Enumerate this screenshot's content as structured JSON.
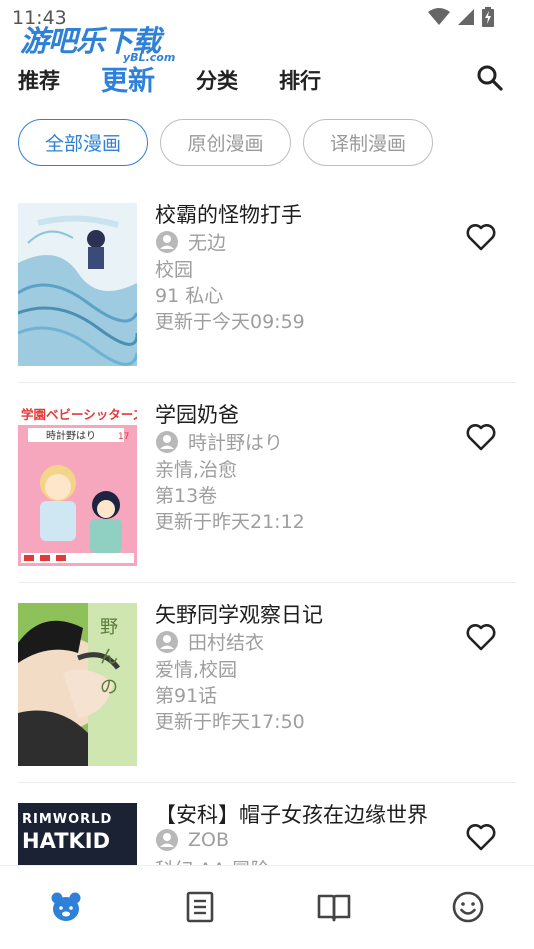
{
  "status": {
    "time": "11:43"
  },
  "watermark": {
    "main": "游吧乐下载",
    "sub": "yBL.com"
  },
  "nav": {
    "tabs": [
      {
        "label": "推荐",
        "active": false
      },
      {
        "label": "更新",
        "active": true
      },
      {
        "label": "分类",
        "active": false
      },
      {
        "label": "排行",
        "active": false
      }
    ],
    "search_icon": "search-icon"
  },
  "filters": [
    {
      "label": "全部漫画",
      "active": true
    },
    {
      "label": "原创漫画",
      "active": false
    },
    {
      "label": "译制漫画",
      "active": false
    }
  ],
  "comics": [
    {
      "title": "校霸的怪物打手",
      "author": "无边",
      "tags": "校园",
      "chapter": "91 私心",
      "updated": "更新于今天09:59"
    },
    {
      "title": "学园奶爸",
      "author": "時計野はり",
      "tags": "亲情,治愈",
      "chapter": "第13卷",
      "updated": "更新于昨天21:12"
    },
    {
      "title": "矢野同学观察日记",
      "author": "田村结衣",
      "tags": "爱情,校园",
      "chapter": "第91话",
      "updated": "更新于昨天17:50"
    },
    {
      "title": "【安科】帽子女孩在边缘世界",
      "author": "ZOB",
      "tags": "科幻,AA,冒险",
      "chapter": "",
      "updated": ""
    }
  ],
  "covers": {
    "c2_banner": "学園ベビーシッターズ",
    "c2_author": "時計野はり",
    "c2_num": "17",
    "c4_line1": "RIMWORLD",
    "c4_line2": "HATKID"
  },
  "bottom_nav": [
    "bear-home-icon",
    "document-icon",
    "open-book-icon",
    "smiley-icon"
  ],
  "colors": {
    "accent": "#2f80d8",
    "text_muted": "#9e9e9e"
  }
}
